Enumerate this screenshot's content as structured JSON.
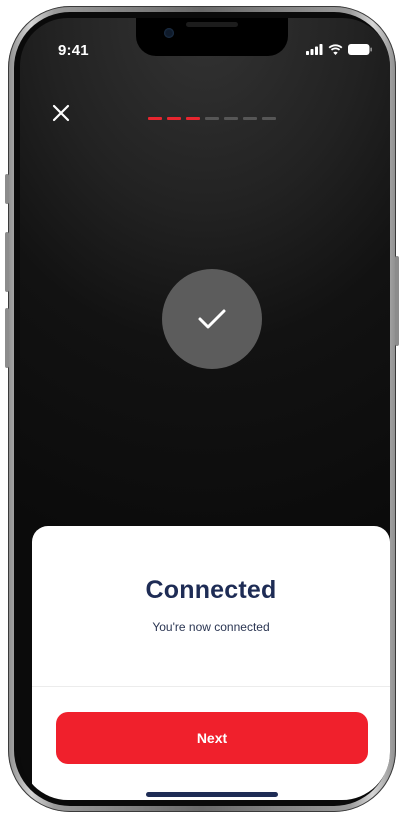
{
  "status_bar": {
    "time": "9:41",
    "icons": [
      "signal-icon",
      "wifi-icon",
      "battery-icon"
    ]
  },
  "header": {
    "close_icon": "close-icon",
    "progress": {
      "total_steps": 7,
      "completed_steps": 3,
      "active_color": "#e8262f",
      "inactive_color": "#565656"
    }
  },
  "status_indicator": {
    "icon": "checkmark-icon",
    "circle_color": "#5c5c5c"
  },
  "sheet": {
    "title": "Connected",
    "subtitle": "You're now connected",
    "title_color": "#1e2c55"
  },
  "actions": {
    "next_label": "Next",
    "next_color": "#f0202c"
  }
}
